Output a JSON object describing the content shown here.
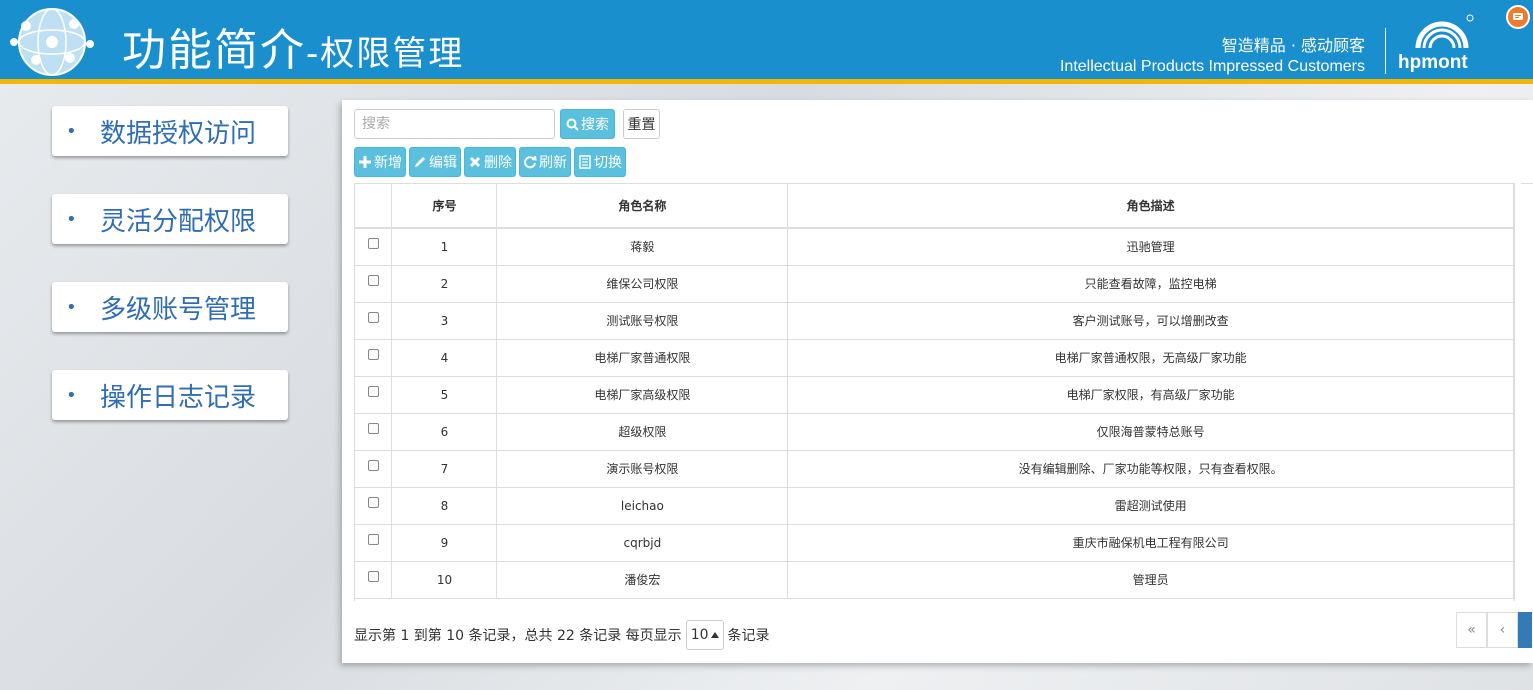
{
  "header": {
    "title_main": "功能简介",
    "title_sub": "-权限管理",
    "slogan_cn": "智造精品 · 感动顾客",
    "slogan_en": "Intellectual Products Impressed Customers",
    "logo_text": "hpmont",
    "brand_color": "#1a8fcd",
    "accent_color": "#f2b705"
  },
  "sidebar": {
    "items": [
      {
        "label": "数据授权访问"
      },
      {
        "label": "灵活分配权限"
      },
      {
        "label": "多级账号管理"
      },
      {
        "label": "操作日志记录"
      }
    ]
  },
  "search": {
    "placeholder": "搜索",
    "search_label": "搜索",
    "reset_label": "重置"
  },
  "toolbar": {
    "add_label": "新增",
    "edit_label": "编辑",
    "delete_label": "删除",
    "refresh_label": "刷新",
    "toggle_label": "切换"
  },
  "table": {
    "columns": [
      "",
      "序号",
      "角色名称",
      "角色描述"
    ],
    "rows": [
      {
        "no": "1",
        "name": "蒋毅",
        "desc": "迅驰管理"
      },
      {
        "no": "2",
        "name": "维保公司权限",
        "desc": "只能查看故障，监控电梯"
      },
      {
        "no": "3",
        "name": "测试账号权限",
        "desc": "客户测试账号，可以增删改查"
      },
      {
        "no": "4",
        "name": "电梯厂家普通权限",
        "desc": "电梯厂家普通权限，无高级厂家功能"
      },
      {
        "no": "5",
        "name": "电梯厂家高级权限",
        "desc": "电梯厂家权限，有高级厂家功能"
      },
      {
        "no": "6",
        "name": "超级权限",
        "desc": "仅限海普蒙特总账号"
      },
      {
        "no": "7",
        "name": "演示账号权限",
        "desc": "没有编辑删除、厂家功能等权限，只有查看权限。"
      },
      {
        "no": "8",
        "name": "leichao",
        "desc": "雷超测试使用"
      },
      {
        "no": "9",
        "name": "cqrbjd",
        "desc": "重庆市融保机电工程有限公司"
      },
      {
        "no": "10",
        "name": "潘俊宏",
        "desc": "管理员"
      }
    ]
  },
  "footer": {
    "summary": "显示第 1 到第 10 条记录，总共 22 条记录 每页显示",
    "page_size": "10",
    "suffix": "条记录"
  },
  "pager": {
    "first": "«",
    "prev": "‹"
  }
}
